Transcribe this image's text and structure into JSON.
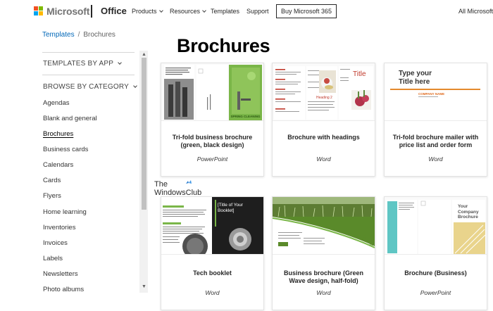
{
  "header": {
    "brand": "Microsoft",
    "product": "Office",
    "nav": [
      "Products",
      "Resources",
      "Templates",
      "Support"
    ],
    "buy_button": "Buy Microsoft 365",
    "all_microsoft": "All Microsoft"
  },
  "breadcrumb": {
    "root": "Templates",
    "separator": "/",
    "current": "Brochures"
  },
  "sidebar": {
    "templates_by_app": "TEMPLATES BY APP",
    "browse_by_category": "BROWSE BY CATEGORY",
    "categories": [
      "Agendas",
      "Blank and general",
      "Brochures",
      "Business cards",
      "Calendars",
      "Cards",
      "Flyers",
      "Home learning",
      "Inventories",
      "Invoices",
      "Labels",
      "Newsletters",
      "Photo albums"
    ],
    "active_category": "Brochures"
  },
  "watermark": {
    "line1": "The",
    "line2": "WindowsClub"
  },
  "main": {
    "title": "Brochures"
  },
  "templates": [
    {
      "title": "Tri-fold business brochure (green, black design)",
      "app": "PowerPoint",
      "thumb_text": {
        "caption": "SPRING CLEANING"
      }
    },
    {
      "title": "Brochure with headings",
      "app": "Word",
      "thumb_text": {
        "title": "Title",
        "heading": "Heading 2"
      }
    },
    {
      "title": "Tri-fold brochure mailer with price list and order form",
      "app": "Word",
      "thumb_text": {
        "line1": "Type your",
        "line2": "Title here",
        "company": "COMPANY NAME"
      }
    },
    {
      "title": "Tech booklet",
      "app": "Word",
      "thumb_text": {
        "line1": "[Title of Your",
        "line2": "Booklet]"
      }
    },
    {
      "title": "Business brochure (Green Wave design, half-fold)",
      "app": "Word",
      "thumb_text": {
        "line1": "COM",
        "line2": "N"
      }
    },
    {
      "title": "Brochure (Business)",
      "app": "PowerPoint",
      "thumb_text": {
        "line1": "Your",
        "line2": "Company",
        "line3": "Brochure"
      }
    }
  ],
  "colors": {
    "link": "#0067b8",
    "brand_green": "#7ab648",
    "ms_red": "#f25022",
    "ms_green": "#7fba00",
    "ms_blue": "#00a4ef",
    "ms_yellow": "#ffb900"
  }
}
